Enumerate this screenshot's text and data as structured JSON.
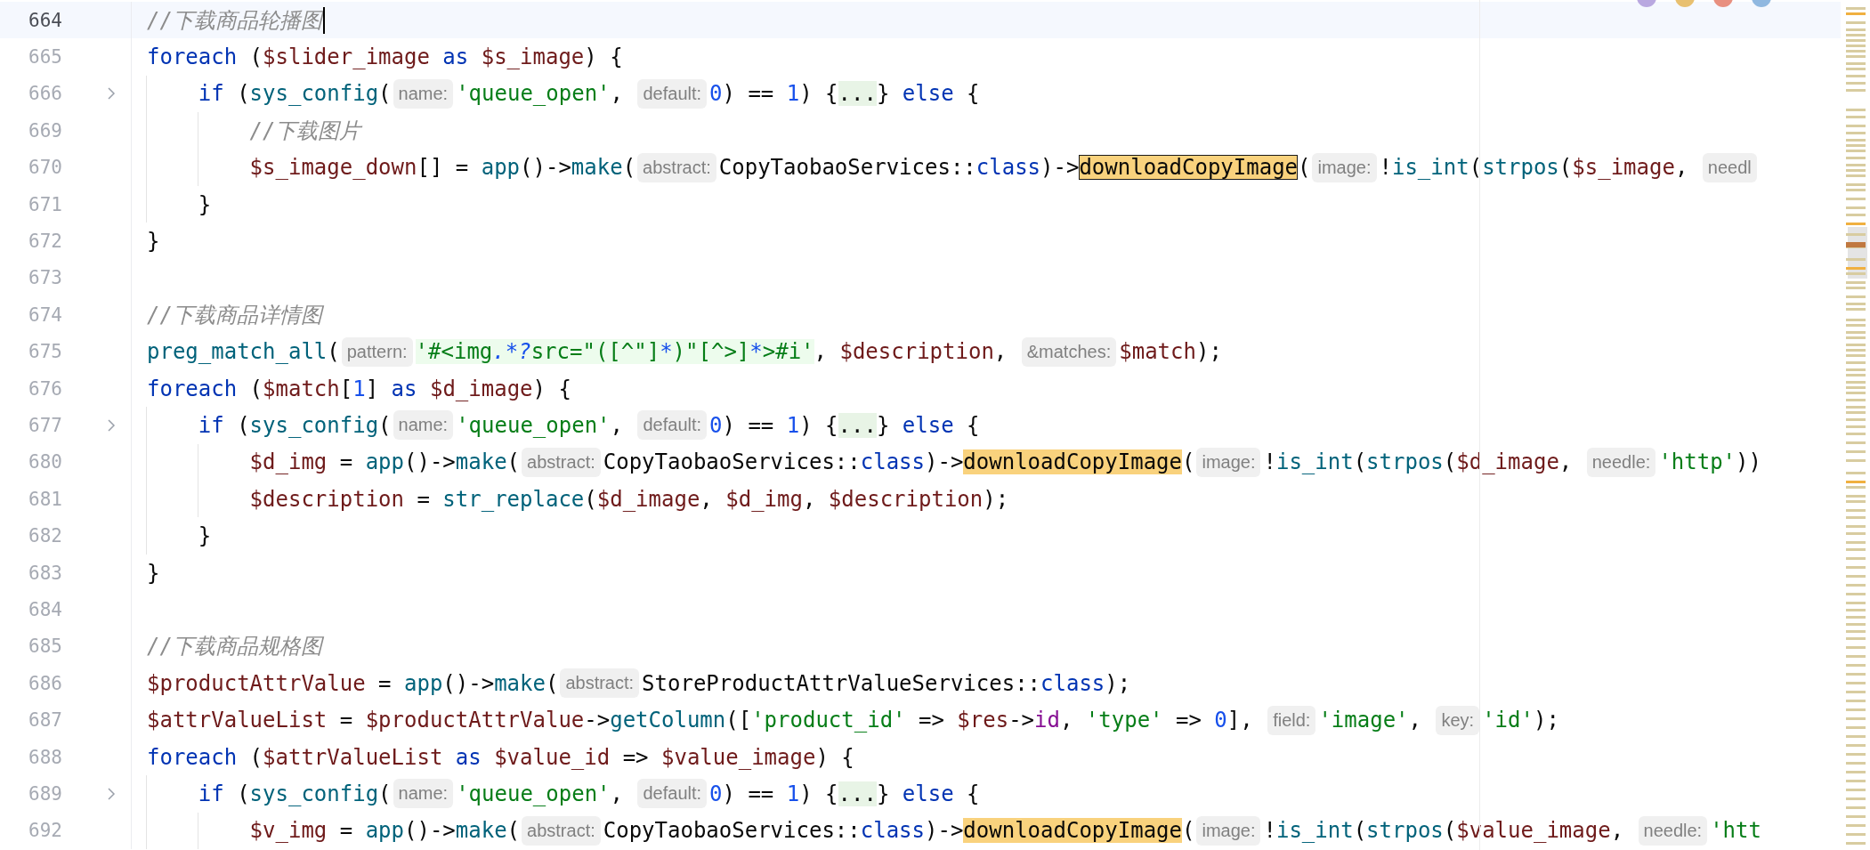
{
  "editor": {
    "lines": [
      {
        "number": "664",
        "current": true,
        "caret": true,
        "foldable": false,
        "tokens": [
          {
            "kind": "comment",
            "text": "//下载商品轮播图"
          }
        ]
      },
      {
        "number": "665",
        "current": false,
        "caret": false,
        "foldable": false,
        "tokens": [
          {
            "kind": "keyword",
            "text": "foreach"
          },
          {
            "kind": "plain",
            "text": " ("
          },
          {
            "kind": "variable",
            "text": "$slider_image"
          },
          {
            "kind": "keyword",
            "text": " as "
          },
          {
            "kind": "variable",
            "text": "$s_image"
          },
          {
            "kind": "plain",
            "text": ") {"
          }
        ],
        "children": [
          {
            "number": "666",
            "current": false,
            "caret": false,
            "foldable": true,
            "tokens": [
              {
                "kind": "keyword",
                "text": "if"
              },
              {
                "kind": "plain",
                "text": " ("
              },
              {
                "kind": "function",
                "text": "sys_config"
              },
              {
                "kind": "plain",
                "text": "("
              },
              {
                "kind": "hint",
                "text": "name:"
              },
              {
                "kind": "string",
                "text": "'queue_open'"
              },
              {
                "kind": "plain",
                "text": ", "
              },
              {
                "kind": "hint",
                "text": "default:"
              },
              {
                "kind": "number",
                "text": "0"
              },
              {
                "kind": "plain",
                "text": ") == "
              },
              {
                "kind": "number",
                "text": "1"
              },
              {
                "kind": "plain",
                "text": ") {"
              },
              {
                "kind": "fold",
                "text": "...",
                "expanded": false
              },
              {
                "kind": "plain",
                "text": "} "
              },
              {
                "kind": "keyword",
                "text": "else"
              },
              {
                "kind": "plain",
                "text": " {"
              }
            ],
            "children": [
              {
                "number": "669",
                "current": false,
                "caret": false,
                "foldable": false,
                "tokens": [
                  {
                    "kind": "comment",
                    "text": "//下载图片"
                  }
                ]
              },
              {
                "number": "670",
                "current": false,
                "caret": false,
                "foldable": false,
                "tokens": [
                  {
                    "kind": "variable",
                    "text": "$s_image_down"
                  },
                  {
                    "kind": "plain",
                    "text": "[] = "
                  },
                  {
                    "kind": "function",
                    "text": "app"
                  },
                  {
                    "kind": "plain",
                    "text": "()->"
                  },
                  {
                    "kind": "function",
                    "text": "make"
                  },
                  {
                    "kind": "plain",
                    "text": "("
                  },
                  {
                    "kind": "hint",
                    "text": "abstract:"
                  },
                  {
                    "kind": "plain",
                    "text": "CopyTaobaoServices::"
                  },
                  {
                    "kind": "keyword",
                    "text": "class"
                  },
                  {
                    "kind": "plain",
                    "text": ")->"
                  },
                  {
                    "kind": "match",
                    "text": "downloadCopyImage",
                    "selected": true
                  },
                  {
                    "kind": "plain",
                    "text": "("
                  },
                  {
                    "kind": "hint",
                    "text": "image:"
                  },
                  {
                    "kind": "plain",
                    "text": "!"
                  },
                  {
                    "kind": "function",
                    "text": "is_int"
                  },
                  {
                    "kind": "plain",
                    "text": "("
                  },
                  {
                    "kind": "function",
                    "text": "strpos"
                  },
                  {
                    "kind": "plain",
                    "text": "("
                  },
                  {
                    "kind": "variable",
                    "text": "$s_image"
                  },
                  {
                    "kind": "plain",
                    "text": ", "
                  },
                  {
                    "kind": "hint",
                    "text": "needl"
                  }
                ]
              }
            ]
          },
          {
            "number": "671",
            "current": false,
            "caret": false,
            "foldable": false,
            "tokens": [
              {
                "kind": "plain",
                "text": "}"
              }
            ]
          }
        ]
      },
      {
        "number": "672",
        "current": false,
        "caret": false,
        "foldable": false,
        "tokens": [
          {
            "kind": "plain",
            "text": "}"
          }
        ]
      },
      {
        "number": "673",
        "current": false,
        "caret": false,
        "foldable": false
      },
      {
        "number": "674",
        "current": false,
        "caret": false,
        "foldable": false,
        "tokens": [
          {
            "kind": "comment",
            "text": "//下载商品详情图"
          }
        ]
      },
      {
        "number": "675",
        "current": false,
        "caret": false,
        "foldable": false,
        "tokens": [
          {
            "kind": "function",
            "text": "preg_match_all"
          },
          {
            "kind": "plain",
            "text": "("
          },
          {
            "kind": "hint",
            "text": "pattern:"
          },
          {
            "kind": "regex-text",
            "text": "'#<img"
          },
          {
            "kind": "regex-op",
            "text": ".*?"
          },
          {
            "kind": "regex-text",
            "text": "src=\"([^\"]"
          },
          {
            "kind": "regex-op",
            "text": "*"
          },
          {
            "kind": "regex-text",
            "text": ")\"[^>]"
          },
          {
            "kind": "regex-op",
            "text": "*"
          },
          {
            "kind": "regex-text",
            "text": ">#i'"
          },
          {
            "kind": "plain",
            "text": ", "
          },
          {
            "kind": "variable",
            "text": "$description"
          },
          {
            "kind": "plain",
            "text": ", "
          },
          {
            "kind": "hint",
            "text": "&matches:"
          },
          {
            "kind": "variable",
            "text": "$match"
          },
          {
            "kind": "plain",
            "text": ");"
          }
        ]
      },
      {
        "number": "676",
        "current": false,
        "caret": false,
        "foldable": false,
        "tokens": [
          {
            "kind": "keyword",
            "text": "foreach"
          },
          {
            "kind": "plain",
            "text": " ("
          },
          {
            "kind": "variable",
            "text": "$match"
          },
          {
            "kind": "plain",
            "text": "["
          },
          {
            "kind": "number",
            "text": "1"
          },
          {
            "kind": "plain",
            "text": "] "
          },
          {
            "kind": "keyword",
            "text": "as "
          },
          {
            "kind": "variable",
            "text": "$d_image"
          },
          {
            "kind": "plain",
            "text": ") {"
          }
        ],
        "children": [
          {
            "number": "677",
            "current": false,
            "caret": false,
            "foldable": true,
            "tokens": [
              {
                "kind": "keyword",
                "text": "if"
              },
              {
                "kind": "plain",
                "text": " ("
              },
              {
                "kind": "function",
                "text": "sys_config"
              },
              {
                "kind": "plain",
                "text": "("
              },
              {
                "kind": "hint",
                "text": "name:"
              },
              {
                "kind": "string",
                "text": "'queue_open'"
              },
              {
                "kind": "plain",
                "text": ", "
              },
              {
                "kind": "hint",
                "text": "default:"
              },
              {
                "kind": "number",
                "text": "0"
              },
              {
                "kind": "plain",
                "text": ") == "
              },
              {
                "kind": "number",
                "text": "1"
              },
              {
                "kind": "plain",
                "text": ") {"
              },
              {
                "kind": "fold",
                "text": "...",
                "expanded": false
              },
              {
                "kind": "plain",
                "text": "} "
              },
              {
                "kind": "keyword",
                "text": "else"
              },
              {
                "kind": "plain",
                "text": " {"
              }
            ],
            "children": [
              {
                "number": "680",
                "current": false,
                "caret": false,
                "foldable": false,
                "tokens": [
                  {
                    "kind": "variable",
                    "text": "$d_img"
                  },
                  {
                    "kind": "plain",
                    "text": " = "
                  },
                  {
                    "kind": "function",
                    "text": "app"
                  },
                  {
                    "kind": "plain",
                    "text": "()->"
                  },
                  {
                    "kind": "function",
                    "text": "make"
                  },
                  {
                    "kind": "plain",
                    "text": "("
                  },
                  {
                    "kind": "hint",
                    "text": "abstract:"
                  },
                  {
                    "kind": "plain",
                    "text": "CopyTaobaoServices::"
                  },
                  {
                    "kind": "keyword",
                    "text": "class"
                  },
                  {
                    "kind": "plain",
                    "text": ")->"
                  },
                  {
                    "kind": "match",
                    "text": "downloadCopyImage",
                    "selected": false
                  },
                  {
                    "kind": "plain",
                    "text": "("
                  },
                  {
                    "kind": "hint",
                    "text": "image:"
                  },
                  {
                    "kind": "plain",
                    "text": "!"
                  },
                  {
                    "kind": "function",
                    "text": "is_int"
                  },
                  {
                    "kind": "plain",
                    "text": "("
                  },
                  {
                    "kind": "function",
                    "text": "strpos"
                  },
                  {
                    "kind": "plain",
                    "text": "("
                  },
                  {
                    "kind": "variable",
                    "text": "$d_image"
                  },
                  {
                    "kind": "plain",
                    "text": ", "
                  },
                  {
                    "kind": "hint",
                    "text": "needle:"
                  },
                  {
                    "kind": "string",
                    "text": "'http'"
                  },
                  {
                    "kind": "plain",
                    "text": "))"
                  }
                ]
              },
              {
                "number": "681",
                "current": false,
                "caret": false,
                "foldable": false,
                "tokens": [
                  {
                    "kind": "variable",
                    "text": "$description"
                  },
                  {
                    "kind": "plain",
                    "text": " = "
                  },
                  {
                    "kind": "function",
                    "text": "str_replace"
                  },
                  {
                    "kind": "plain",
                    "text": "("
                  },
                  {
                    "kind": "variable",
                    "text": "$d_image"
                  },
                  {
                    "kind": "plain",
                    "text": ", "
                  },
                  {
                    "kind": "variable",
                    "text": "$d_img"
                  },
                  {
                    "kind": "plain",
                    "text": ", "
                  },
                  {
                    "kind": "variable",
                    "text": "$description"
                  },
                  {
                    "kind": "plain",
                    "text": ");"
                  }
                ]
              }
            ]
          },
          {
            "number": "682",
            "current": false,
            "caret": false,
            "foldable": false,
            "tokens": [
              {
                "kind": "plain",
                "text": "}"
              }
            ]
          }
        ]
      },
      {
        "number": "683",
        "current": false,
        "caret": false,
        "foldable": false,
        "tokens": [
          {
            "kind": "plain",
            "text": "}"
          }
        ]
      },
      {
        "number": "684",
        "current": false,
        "caret": false,
        "foldable": false
      },
      {
        "number": "685",
        "current": false,
        "caret": false,
        "foldable": false,
        "tokens": [
          {
            "kind": "comment",
            "text": "//下载商品规格图"
          }
        ]
      },
      {
        "number": "686",
        "current": false,
        "caret": false,
        "foldable": false,
        "tokens": [
          {
            "kind": "variable",
            "text": "$productAttrValue"
          },
          {
            "kind": "plain",
            "text": " = "
          },
          {
            "kind": "function",
            "text": "app"
          },
          {
            "kind": "plain",
            "text": "()->"
          },
          {
            "kind": "function",
            "text": "make"
          },
          {
            "kind": "plain",
            "text": "("
          },
          {
            "kind": "hint",
            "text": "abstract:"
          },
          {
            "kind": "plain",
            "text": "StoreProductAttrValueServices::"
          },
          {
            "kind": "keyword",
            "text": "class"
          },
          {
            "kind": "plain",
            "text": ");"
          }
        ]
      },
      {
        "number": "687",
        "current": false,
        "caret": false,
        "foldable": false,
        "tokens": [
          {
            "kind": "variable",
            "text": "$attrValueList"
          },
          {
            "kind": "plain",
            "text": " = "
          },
          {
            "kind": "variable",
            "text": "$productAttrValue"
          },
          {
            "kind": "plain",
            "text": "->"
          },
          {
            "kind": "function",
            "text": "getColumn"
          },
          {
            "kind": "plain",
            "text": "(["
          },
          {
            "kind": "string",
            "text": "'product_id'"
          },
          {
            "kind": "plain",
            "text": " => "
          },
          {
            "kind": "variable",
            "text": "$res"
          },
          {
            "kind": "plain",
            "text": "->"
          },
          {
            "kind": "property",
            "text": "id"
          },
          {
            "kind": "plain",
            "text": ", "
          },
          {
            "kind": "string",
            "text": "'type'"
          },
          {
            "kind": "plain",
            "text": " => "
          },
          {
            "kind": "number",
            "text": "0"
          },
          {
            "kind": "plain",
            "text": "], "
          },
          {
            "kind": "hint",
            "text": "field:"
          },
          {
            "kind": "string",
            "text": "'image'"
          },
          {
            "kind": "plain",
            "text": ", "
          },
          {
            "kind": "hint",
            "text": "key:"
          },
          {
            "kind": "string",
            "text": "'id'"
          },
          {
            "kind": "plain",
            "text": ");"
          }
        ]
      },
      {
        "number": "688",
        "current": false,
        "caret": false,
        "foldable": false,
        "tokens": [
          {
            "kind": "keyword",
            "text": "foreach"
          },
          {
            "kind": "plain",
            "text": " ("
          },
          {
            "kind": "variable",
            "text": "$attrValueList"
          },
          {
            "kind": "keyword",
            "text": " as "
          },
          {
            "kind": "variable",
            "text": "$value_id"
          },
          {
            "kind": "plain",
            "text": " => "
          },
          {
            "kind": "variable",
            "text": "$value_image"
          },
          {
            "kind": "plain",
            "text": ") {"
          }
        ],
        "children": [
          {
            "number": "689",
            "current": false,
            "caret": false,
            "foldable": true,
            "tokens": [
              {
                "kind": "keyword",
                "text": "if"
              },
              {
                "kind": "plain",
                "text": " ("
              },
              {
                "kind": "function",
                "text": "sys_config"
              },
              {
                "kind": "plain",
                "text": "("
              },
              {
                "kind": "hint",
                "text": "name:"
              },
              {
                "kind": "string",
                "text": "'queue_open'"
              },
              {
                "kind": "plain",
                "text": ", "
              },
              {
                "kind": "hint",
                "text": "default:"
              },
              {
                "kind": "number",
                "text": "0"
              },
              {
                "kind": "plain",
                "text": ") == "
              },
              {
                "kind": "number",
                "text": "1"
              },
              {
                "kind": "plain",
                "text": ") {"
              },
              {
                "kind": "fold",
                "text": "...",
                "expanded": false
              },
              {
                "kind": "plain",
                "text": "} "
              },
              {
                "kind": "keyword",
                "text": "else"
              },
              {
                "kind": "plain",
                "text": " {"
              }
            ],
            "children": [
              {
                "number": "692",
                "current": false,
                "caret": false,
                "foldable": false,
                "tokens": [
                  {
                    "kind": "variable",
                    "text": "$v_img"
                  },
                  {
                    "kind": "plain",
                    "text": " = "
                  },
                  {
                    "kind": "function",
                    "text": "app"
                  },
                  {
                    "kind": "plain",
                    "text": "()->"
                  },
                  {
                    "kind": "function",
                    "text": "make"
                  },
                  {
                    "kind": "plain",
                    "text": "("
                  },
                  {
                    "kind": "hint",
                    "text": "abstract:"
                  },
                  {
                    "kind": "plain",
                    "text": "CopyTaobaoServices::"
                  },
                  {
                    "kind": "keyword",
                    "text": "class"
                  },
                  {
                    "kind": "plain",
                    "text": ")->"
                  },
                  {
                    "kind": "match",
                    "text": "downloadCopyImage",
                    "selected": false
                  },
                  {
                    "kind": "plain",
                    "text": "("
                  },
                  {
                    "kind": "hint",
                    "text": "image:"
                  },
                  {
                    "kind": "plain",
                    "text": "!"
                  },
                  {
                    "kind": "function",
                    "text": "is_int"
                  },
                  {
                    "kind": "plain",
                    "text": "("
                  },
                  {
                    "kind": "function",
                    "text": "strpos"
                  },
                  {
                    "kind": "plain",
                    "text": "("
                  },
                  {
                    "kind": "variable",
                    "text": "$value_image"
                  },
                  {
                    "kind": "plain",
                    "text": ", "
                  },
                  {
                    "kind": "hint",
                    "text": "needle:"
                  },
                  {
                    "kind": "string",
                    "text": "'htt"
                  }
                ]
              }
            ]
          }
        ]
      }
    ]
  }
}
